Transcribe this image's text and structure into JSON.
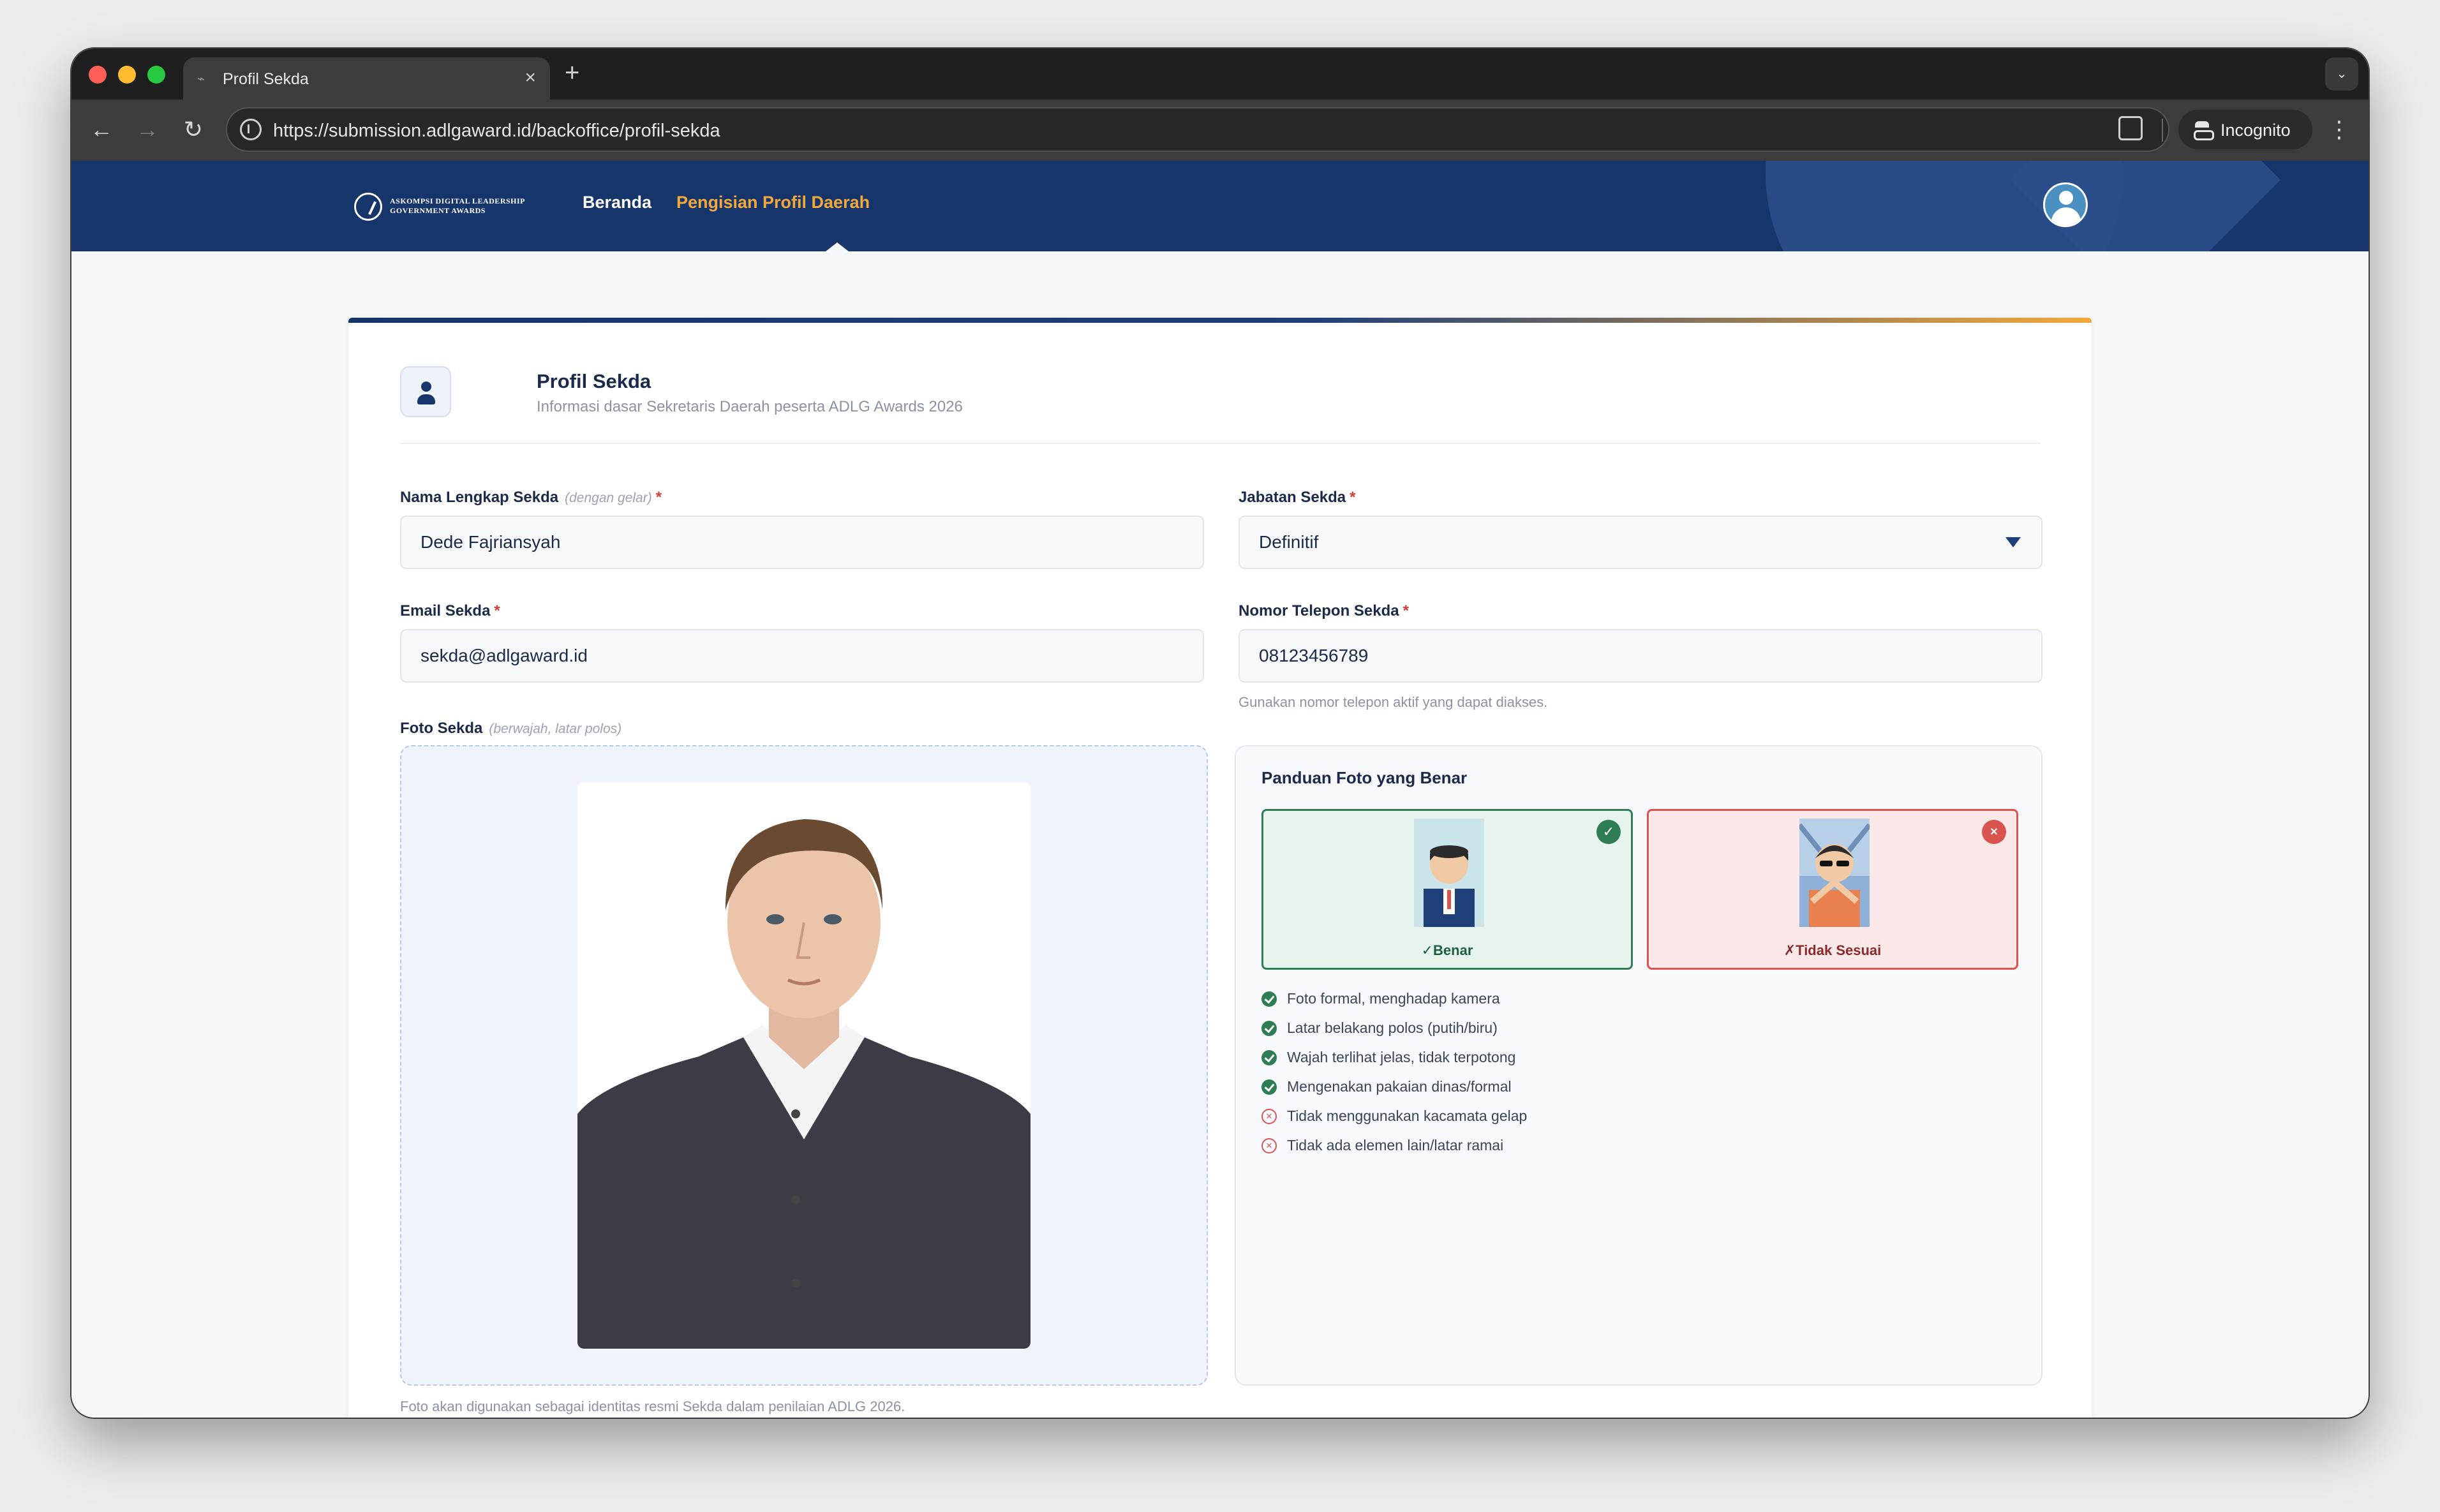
{
  "browser": {
    "tab_title": "Profil Sekda",
    "tab_close": "×",
    "new_tab": "+",
    "url": "https://submission.adlgaward.id/backoffice/profil-sekda",
    "incognito_label": "Incognito",
    "back": "←",
    "forward": "→",
    "reload": "↻",
    "menu": "⋮",
    "dropdown": "⌄"
  },
  "header": {
    "logo_line1": "ASKOMPSI DIGITAL LEADERSHIP",
    "logo_line2": "GOVERNMENT AWARDS",
    "nav": {
      "home": "Beranda",
      "profile": "Pengisian Profil Daerah"
    }
  },
  "section": {
    "title": "Profil Sekda",
    "subtitle": "Informasi dasar Sekretaris Daerah peserta ADLG Awards 2026"
  },
  "form": {
    "name": {
      "label": "Nama Lengkap Sekda",
      "hint": "(dengan gelar)",
      "required": "*",
      "value": "Dede Fajriansyah"
    },
    "position": {
      "label": "Jabatan Sekda",
      "required": "*",
      "value": "Definitif"
    },
    "email": {
      "label": "Email Sekda",
      "required": "*",
      "value": "sekda@adlgaward.id"
    },
    "phone": {
      "label": "Nomor Telepon Sekda",
      "required": "*",
      "value": "08123456789",
      "help": "Gunakan nomor telepon aktif yang dapat diakses."
    },
    "photo": {
      "label": "Foto Sekda",
      "hint": "(berwajah, latar polos)",
      "note": "Foto akan digunakan sebagai identitas resmi Sekda dalam penilaian ADLG 2026."
    }
  },
  "guide": {
    "title": "Panduan Foto yang Benar",
    "good_label": "✓Benar",
    "bad_label": "✗Tidak Sesuai",
    "good_badge": "✓",
    "bad_badge": "×",
    "rules": [
      {
        "text": "Foto formal, menghadap kamera",
        "ok": true
      },
      {
        "text": "Latar belakang polos (putih/biru)",
        "ok": true
      },
      {
        "text": "Wajah terlihat jelas, tidak terpotong",
        "ok": true
      },
      {
        "text": "Mengenakan pakaian dinas/formal",
        "ok": true
      },
      {
        "text": "Tidak menggunakan kacamata gelap",
        "ok": false
      },
      {
        "text": "Tidak ada elemen lain/latar ramai",
        "ok": false
      }
    ],
    "bad_mark": "×"
  },
  "colors": {
    "header_bg": "#16356b",
    "accent_orange": "#f2a93b",
    "ok_green": "#2e7d55",
    "error_red": "#d9534f"
  }
}
